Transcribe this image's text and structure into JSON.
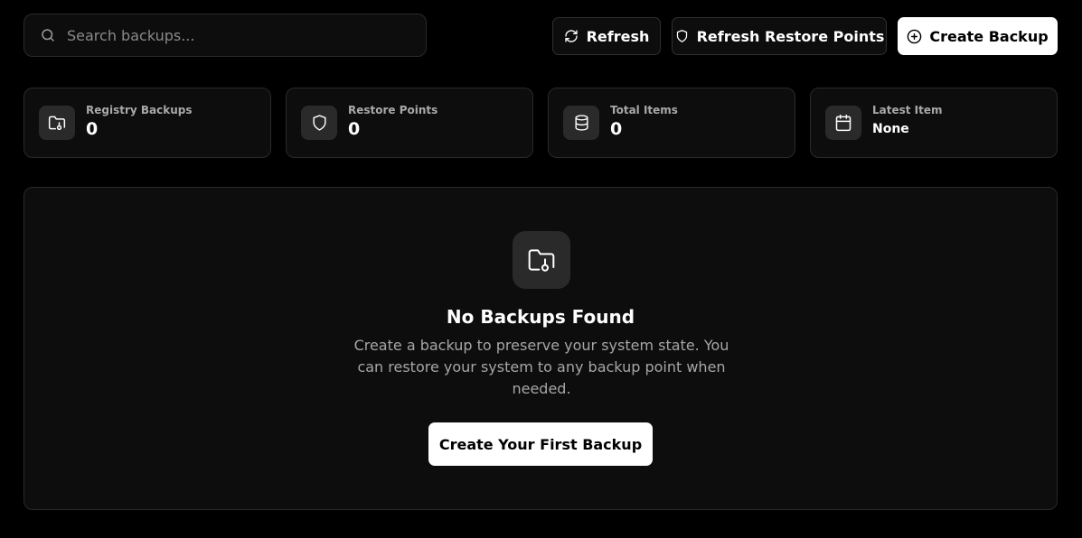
{
  "toolbar": {
    "search_placeholder": "Search backups...",
    "refresh_label": "Refresh",
    "refresh_restore_points_label": "Refresh Restore Points",
    "create_backup_label": "Create Backup"
  },
  "stats": [
    {
      "label": "Registry Backups",
      "value": "0",
      "icon": "folder-lock-icon"
    },
    {
      "label": "Restore Points",
      "value": "0",
      "icon": "shield-icon"
    },
    {
      "label": "Total Items",
      "value": "0",
      "icon": "database-icon"
    },
    {
      "label": "Latest Item",
      "value": "None",
      "icon": "calendar-icon"
    }
  ],
  "empty_state": {
    "icon": "folder-lock-icon",
    "title": "No Backups Found",
    "description": "Create a backup to preserve your system state. You can restore your system to any backup point when needed.",
    "button_label": "Create Your First Backup"
  },
  "colors": {
    "background": "#000000",
    "surface": "#0d0d0d",
    "border": "#2a2a2a",
    "icon_tile": "#2a2a2a",
    "primary_button": "#ffffff"
  }
}
